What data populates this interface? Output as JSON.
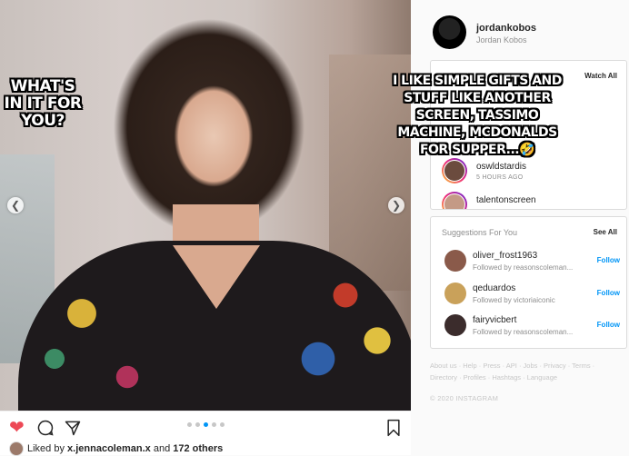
{
  "meme": {
    "left_text": "WHAT'S IN IT FOR YOU?",
    "right_text": "I LIKE SIMPLE GIFTS AND STUFF LIKE ANOTHER SCREEN, TASSIMO MACHINE, MCDONALDS FOR SUPPER...🤣"
  },
  "post": {
    "liked_by_prefix": "Liked by",
    "liked_by_user": "x.jennacoleman.x",
    "liked_by_and": "and",
    "liked_by_others": "172 others",
    "carousel_count": 5,
    "carousel_active": 3
  },
  "profile": {
    "username": "jordankobos",
    "full_name": "Jordan Kobos"
  },
  "stories": {
    "header": "",
    "watch_all": "Watch All",
    "items": [
      {
        "username": "oswldstardis",
        "time": "5 HOURS AGO",
        "color": "#6b4b3e"
      },
      {
        "username": "talentonscreen",
        "time": "",
        "color": "#c49a86"
      }
    ]
  },
  "suggestions": {
    "header": "Suggestions For You",
    "see_all": "See All",
    "follow_label": "Follow",
    "items": [
      {
        "username": "oliver_frost1963",
        "followed_by": "Followed by reasonscoleman...",
        "color": "#8a5a4a"
      },
      {
        "username": "qeduardos",
        "followed_by": "Followed by victoriaiconic",
        "color": "#c9a15a"
      },
      {
        "username": "fairyvicbert",
        "followed_by": "Followed by reasonscoleman...",
        "color": "#3b2c2c"
      }
    ]
  },
  "footer": {
    "links": "About us · Help · Press · API · Jobs · Privacy · Terms · Directory · Profiles · Hashtags · Language",
    "copyright": "© 2020 INSTAGRAM"
  },
  "colors": {
    "like_red": "#ed4956",
    "link_blue": "#0095f6",
    "muted_gray": "#8e8e8e"
  }
}
